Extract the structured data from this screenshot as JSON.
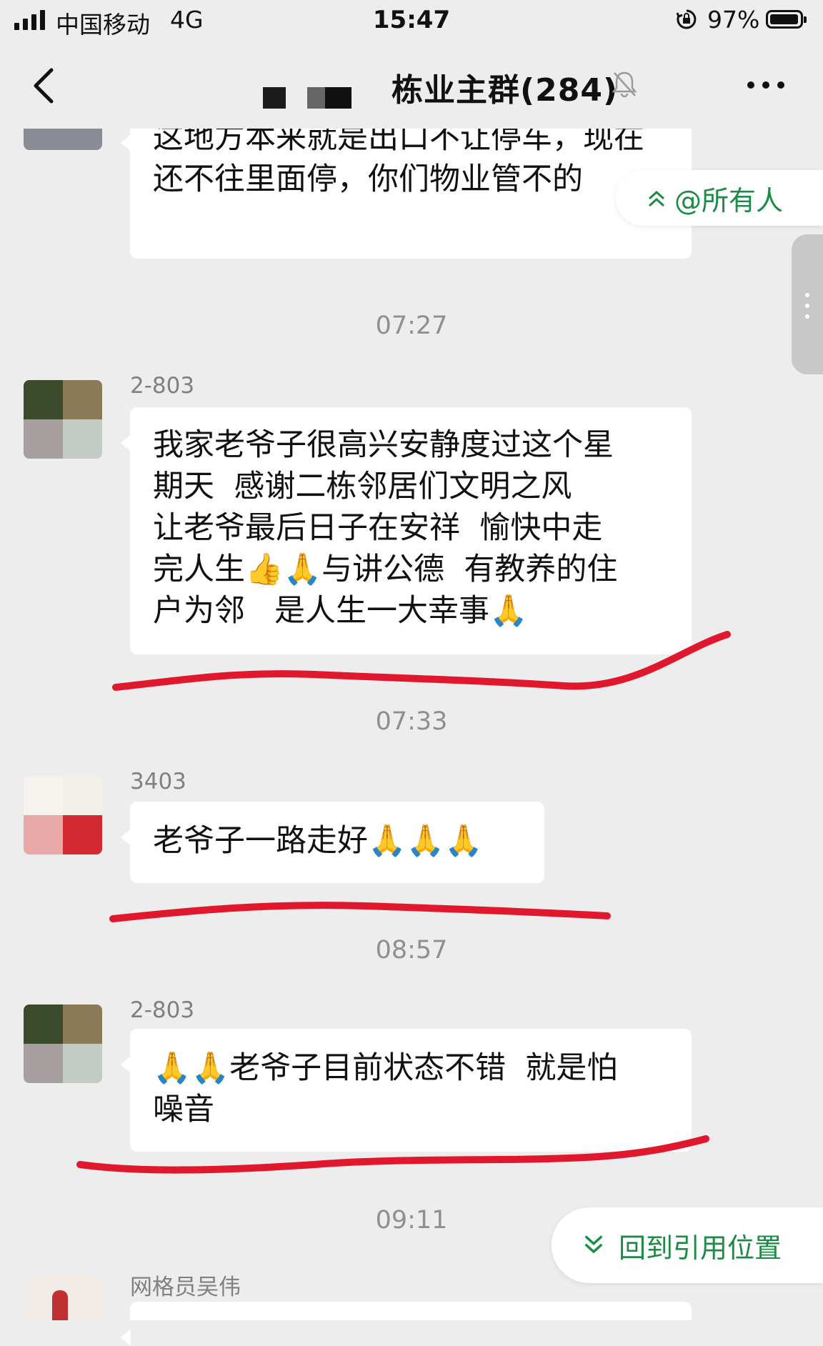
{
  "status_bar": {
    "carrier": "中国移动",
    "network": "4G",
    "time": "15:47",
    "battery": "97%"
  },
  "nav": {
    "title": "栋业主群(284)"
  },
  "messages": [
    {
      "text": "这地方本来就是出口不让停车，现在还不往里面停，你们物业管不的"
    },
    {
      "timestamp": "07:27",
      "sender": "2-803",
      "text": "我家老爷子很高兴安静度过这个星\n期天  感谢二栋邻居们文明之风\n让老爷最后日子在安祥  愉快中走\n完人生👍🙏与讲公德  有教养的住\n户为邻   是人生一大幸事🙏"
    },
    {
      "timestamp": "07:33",
      "sender": "3403",
      "text": "老爷子一路走好🙏🙏🙏"
    },
    {
      "timestamp": "08:57",
      "sender": "2-803",
      "text": "🙏🙏老爷子目前状态不错  就是怕\n噪音"
    },
    {
      "timestamp": "09:11",
      "sender": "网格员吴伟",
      "text": ""
    }
  ],
  "floating": {
    "mention_all": "@所有人",
    "back_to_quote": "回到引用位置"
  },
  "colors": {
    "accent_green": "#1d8a45",
    "underline_red": "#e0182e",
    "background": "#ededed"
  },
  "icons": {
    "back": "chevron-left-icon",
    "mute": "bell-off-icon",
    "more": "more-dots-icon",
    "mention": "double-chevron-up-icon",
    "quote": "double-chevron-down-icon"
  }
}
